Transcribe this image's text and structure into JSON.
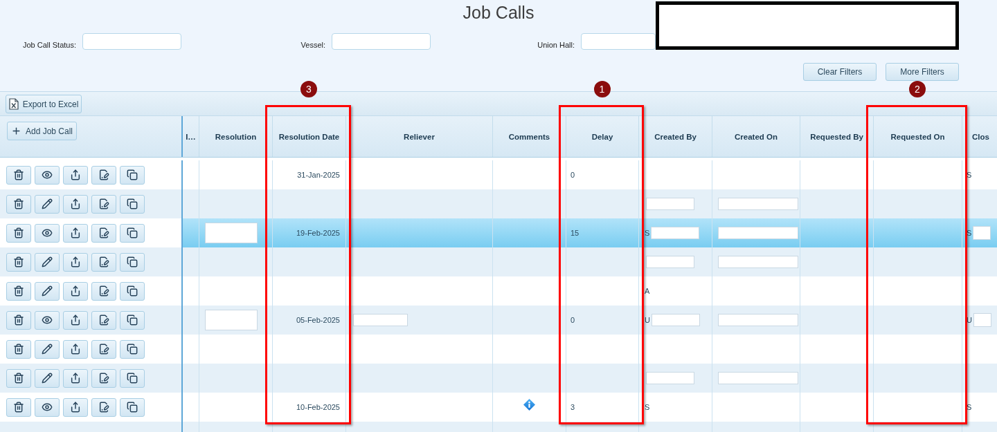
{
  "page": {
    "title": "Job Calls"
  },
  "filters": [
    {
      "label": "Job Call Status:"
    },
    {
      "label": "Vessel:"
    },
    {
      "label": "Union Hall:"
    }
  ],
  "filter_buttons": [
    {
      "label": "Clear Filters"
    },
    {
      "label": "More Filters"
    }
  ],
  "toolbar": {
    "export_label": "Export to Excel",
    "add_label": "Add Job Call"
  },
  "table": {
    "columns": [
      {
        "label": "I…"
      },
      {
        "label": "Resolution"
      },
      {
        "label": "Resolution Date",
        "callout": "3"
      },
      {
        "label": "Reliever"
      },
      {
        "label": "Comments"
      },
      {
        "label": "Delay",
        "callout": "1"
      },
      {
        "label": "Created By"
      },
      {
        "label": "Created On"
      },
      {
        "label": "Requested By"
      },
      {
        "label": "Requested On",
        "callout": "2"
      },
      {
        "label": "Clos"
      }
    ],
    "rows": [
      {
        "kind": "view",
        "selected": false,
        "resolution_date": "31-Jan-2025",
        "delay": "0",
        "closing": "S",
        "has_info": false,
        "resolution_hidden": false,
        "reliever_hidden": false,
        "created_by_hidden": false,
        "created_on_hidden": false,
        "closing_hidden": false
      },
      {
        "kind": "edit",
        "selected": false,
        "has_info": false,
        "resolution_hidden": false,
        "reliever_hidden": false,
        "created_by_hidden": true,
        "created_on_hidden": true,
        "closing_hidden": false
      },
      {
        "kind": "view",
        "selected": true,
        "resolution_date": "19-Feb-2025",
        "delay": "15",
        "created_by": "S",
        "closing": "S",
        "has_info": false,
        "resolution_hidden": true,
        "reliever_hidden": false,
        "created_by_hidden": true,
        "created_on_hidden": true,
        "closing_hidden": true
      },
      {
        "kind": "edit",
        "selected": false,
        "has_info": false,
        "resolution_hidden": false,
        "reliever_hidden": false,
        "created_by_hidden": true,
        "created_on_hidden": true,
        "closing_hidden": false
      },
      {
        "kind": "edit",
        "selected": false,
        "created_by": "A",
        "has_info": false,
        "resolution_hidden": false,
        "reliever_hidden": false,
        "created_by_hidden": false,
        "created_on_hidden": false,
        "closing_hidden": false
      },
      {
        "kind": "view",
        "selected": false,
        "resolution_date": "05-Feb-2025",
        "delay": "0",
        "created_by": "U",
        "closing": "U",
        "has_info": false,
        "resolution_hidden": true,
        "reliever_hidden": true,
        "created_by_hidden": true,
        "created_on_hidden": true,
        "closing_hidden": true
      },
      {
        "kind": "edit",
        "selected": false,
        "has_info": false,
        "resolution_hidden": false,
        "reliever_hidden": false,
        "created_by_hidden": false,
        "created_on_hidden": false,
        "closing_hidden": false
      },
      {
        "kind": "edit",
        "selected": false,
        "has_info": false,
        "resolution_hidden": false,
        "reliever_hidden": false,
        "created_by_hidden": true,
        "created_on_hidden": true,
        "closing_hidden": false
      },
      {
        "kind": "view",
        "selected": false,
        "resolution_date": "10-Feb-2025",
        "delay": "3",
        "created_by": "S",
        "closing": "S",
        "has_info": true,
        "resolution_hidden": false,
        "reliever_hidden": false,
        "created_by_hidden": false,
        "created_on_hidden": false,
        "closing_hidden": false
      }
    ]
  }
}
